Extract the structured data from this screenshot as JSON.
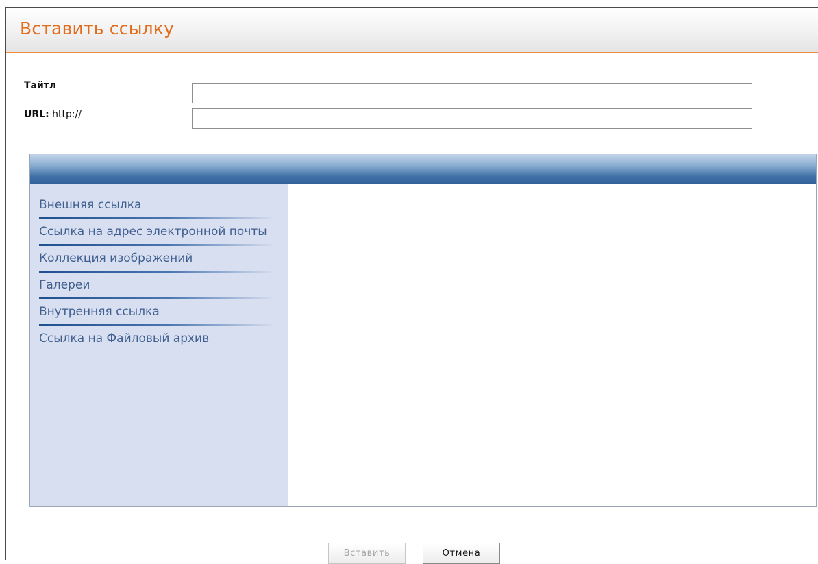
{
  "dialog": {
    "title": "Вставить ссылку"
  },
  "form": {
    "title_label": "Тайтл",
    "url_label_bold": "URL:",
    "url_label_prefix": " http://",
    "title_value": "",
    "url_value": ""
  },
  "link_types": [
    {
      "label": "Внешняя ссылка"
    },
    {
      "label": "Ссылка на адрес электронной почты"
    },
    {
      "label": "Коллекция изображений"
    },
    {
      "label": "Галереи"
    },
    {
      "label": "Внутренняя ссылка"
    },
    {
      "label": "Ссылка на Файловый архив"
    }
  ],
  "buttons": {
    "insert_label": "Вставить",
    "cancel_label": "Отмена"
  },
  "colors": {
    "title_orange": "#e36c1c",
    "accent_orange_line": "#ef8a3a",
    "header_blue": "#3f6fa6",
    "sidebar_bg": "#d8dff0",
    "link_text": "#3f5f8f"
  }
}
